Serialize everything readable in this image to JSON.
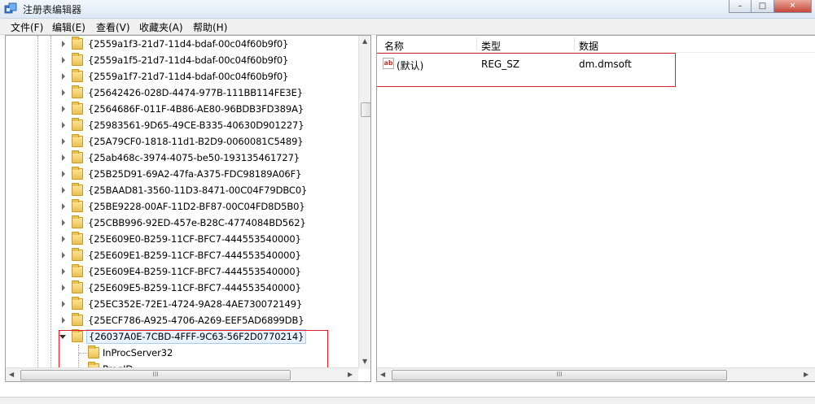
{
  "window": {
    "title": "注册表编辑器",
    "minimize_glyph": "–",
    "maximize_glyph": "□",
    "close_glyph": "✕"
  },
  "menu": [
    {
      "label": "文件(F)"
    },
    {
      "label": "编辑(E)"
    },
    {
      "label": "查看(V)"
    },
    {
      "label": "收藏夹(A)"
    },
    {
      "label": "帮助(H)"
    }
  ],
  "tree": {
    "items": [
      {
        "label": "{2559a1f3-21d7-11d4-bdaf-00c04f60b9f0}"
      },
      {
        "label": "{2559a1f5-21d7-11d4-bdaf-00c04f60b9f0}"
      },
      {
        "label": "{2559a1f7-21d7-11d4-bdaf-00c04f60b9f0}"
      },
      {
        "label": "{25642426-028D-4474-977B-111BB114FE3E}"
      },
      {
        "label": "{2564686F-011F-4B86-AE80-96BDB3FD389A}"
      },
      {
        "label": "{25983561-9D65-49CE-B335-40630D901227}"
      },
      {
        "label": "{25A79CF0-1818-11d1-B2D9-0060081C5489}"
      },
      {
        "label": "{25ab468c-3974-4075-be50-193135461727}"
      },
      {
        "label": "{25B25D91-69A2-47fa-A375-FDC98189A06F}"
      },
      {
        "label": "{25BAAD81-3560-11D3-8471-00C04F79DBC0}"
      },
      {
        "label": "{25BE9228-00AF-11D2-BF87-00C04FD8D5B0}"
      },
      {
        "label": "{25CBB996-92ED-457e-B28C-4774084BD562}"
      },
      {
        "label": "{25E609E0-B259-11CF-BFC7-444553540000}"
      },
      {
        "label": "{25E609E1-B259-11CF-BFC7-444553540000}"
      },
      {
        "label": "{25E609E4-B259-11CF-BFC7-444553540000}"
      },
      {
        "label": "{25E609E5-B259-11CF-BFC7-444553540000}"
      },
      {
        "label": "{25EC352E-72E1-4724-9A28-4AE730072149}"
      },
      {
        "label": "{25ECF786-A925-4706-A269-EEF5AD6899DB}"
      }
    ],
    "selected": {
      "label": "{26037A0E-7CBD-4FFF-9C63-56F2D0770214}"
    },
    "children": [
      {
        "label": "InProcServer32"
      },
      {
        "label": "ProgID"
      }
    ]
  },
  "values": {
    "headers": {
      "name": "名称",
      "type": "类型",
      "data": "数据"
    },
    "rows": [
      {
        "name": "(默认)",
        "type": "REG_SZ",
        "data": "dm.dmsoft",
        "icon_text": "ab"
      }
    ]
  },
  "scroll": {
    "grip": "III",
    "up": "▲",
    "down": "▼",
    "left": "◀",
    "right": "▶"
  },
  "colors": {
    "highlight_box": "#e0202a",
    "selection_bg": "#e8f2fc"
  }
}
